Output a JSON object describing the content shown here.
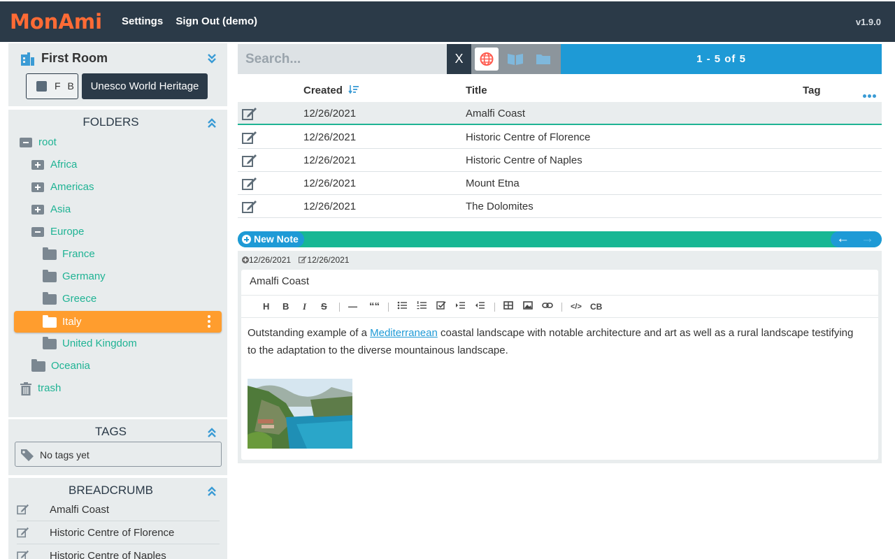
{
  "app": {
    "logo": "MonAmi",
    "version": "v1.9.0"
  },
  "topnav": {
    "settings": "Settings",
    "signout": "Sign Out (demo)"
  },
  "room": {
    "title": "First Room",
    "fb_button": "F B",
    "collection_button": "Unesco World Heritage"
  },
  "folders": {
    "title": "FOLDERS",
    "root": "root",
    "items": [
      "Africa",
      "Americas",
      "Asia",
      "Europe",
      "France",
      "Germany",
      "Greece",
      "Italy",
      "United Kingdom",
      "Oceania"
    ],
    "trash": "trash"
  },
  "tags": {
    "title": "TAGS",
    "empty": "No tags yet"
  },
  "breadcrumb": {
    "title": "BREADCRUMB",
    "items": [
      "Amalfi Coast",
      "Historic Centre of Florence",
      "Historic Centre of Naples"
    ]
  },
  "search": {
    "placeholder": "Search...",
    "clear": "X",
    "pager": "1 - 5  of  5"
  },
  "table": {
    "headers": {
      "created": "Created",
      "title": "Title",
      "tag": "Tag"
    },
    "rows": [
      {
        "created": "12/26/2021",
        "title": "Amalfi Coast"
      },
      {
        "created": "12/26/2021",
        "title": "Historic Centre of Florence"
      },
      {
        "created": "12/26/2021",
        "title": "Historic Centre of Naples"
      },
      {
        "created": "12/26/2021",
        "title": "Mount Etna"
      },
      {
        "created": "12/26/2021",
        "title": "The Dolomites"
      }
    ]
  },
  "note_bar": {
    "new_note": "New Note"
  },
  "note": {
    "created": "12/26/2021",
    "modified": "12/26/2021",
    "title": "Amalfi Coast",
    "body_before": "Outstanding example of a ",
    "body_link": "Mediterranean",
    "body_after": " coastal landscape with notable architecture and art as well as a rural landscape testifying to the adaptation to the diverse mountainous landscape."
  },
  "toolbar": {
    "heading": "H",
    "bold": "B",
    "italic": "I",
    "strike": "S",
    "rule": "—",
    "quote": "““",
    "code": "</>",
    "codeblock": "CB"
  },
  "colors": {
    "topbar": "#2b3a48",
    "logo": "#ff6b35",
    "accent_green": "#1fb394",
    "accent_blue": "#1e9ad6",
    "selected_folder": "#ff9d2e"
  }
}
